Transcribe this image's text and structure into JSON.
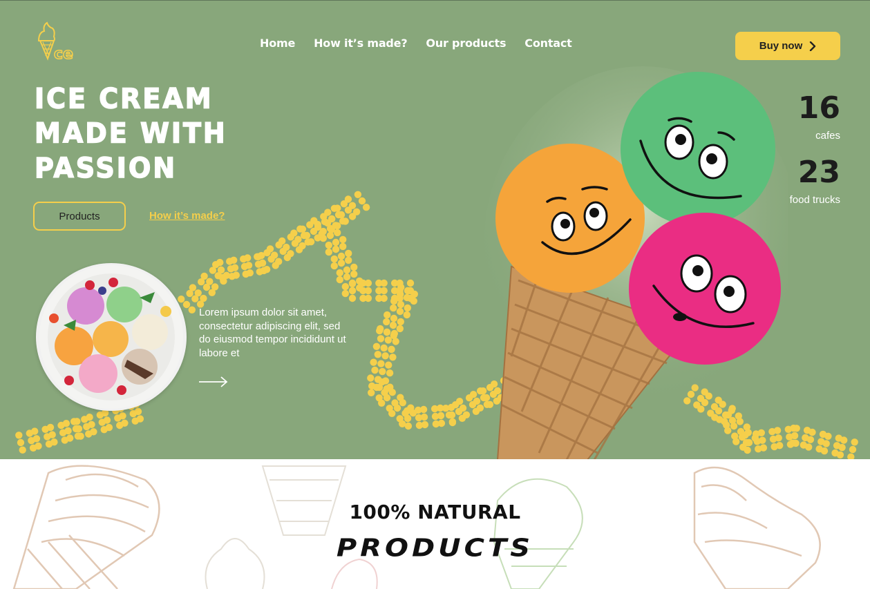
{
  "colors": {
    "hero_bg": "#88a77b",
    "accent_yellow": "#f5cf4b",
    "text_dark": "#1c1c1c",
    "white": "#ffffff"
  },
  "logo": {
    "text": "ce",
    "icon": "ice-cream-cone-logo-icon"
  },
  "nav": {
    "items": [
      "Home",
      "How it’s made?",
      "Our products",
      "Contact"
    ]
  },
  "header": {
    "buy_label": "Buy now",
    "buy_icon": "chevron-right-icon"
  },
  "hero": {
    "title_lines": [
      "ICE CREAM",
      "MADE WITH",
      "PASSION"
    ],
    "products_button": "Products",
    "how_link": "How it’s made?",
    "description": "Lorem ipsum dolor sit amet, consectetur adipiscing elit, sed do eiusmod tempor incididunt ut labore et",
    "arrow_icon": "arrow-right-icon"
  },
  "stats": [
    {
      "value": "16",
      "label": "cafes"
    },
    {
      "value": "23",
      "label": "food trucks"
    }
  ],
  "section": {
    "kicker": "100% NATURAL",
    "heading": "PRODUCTS"
  }
}
